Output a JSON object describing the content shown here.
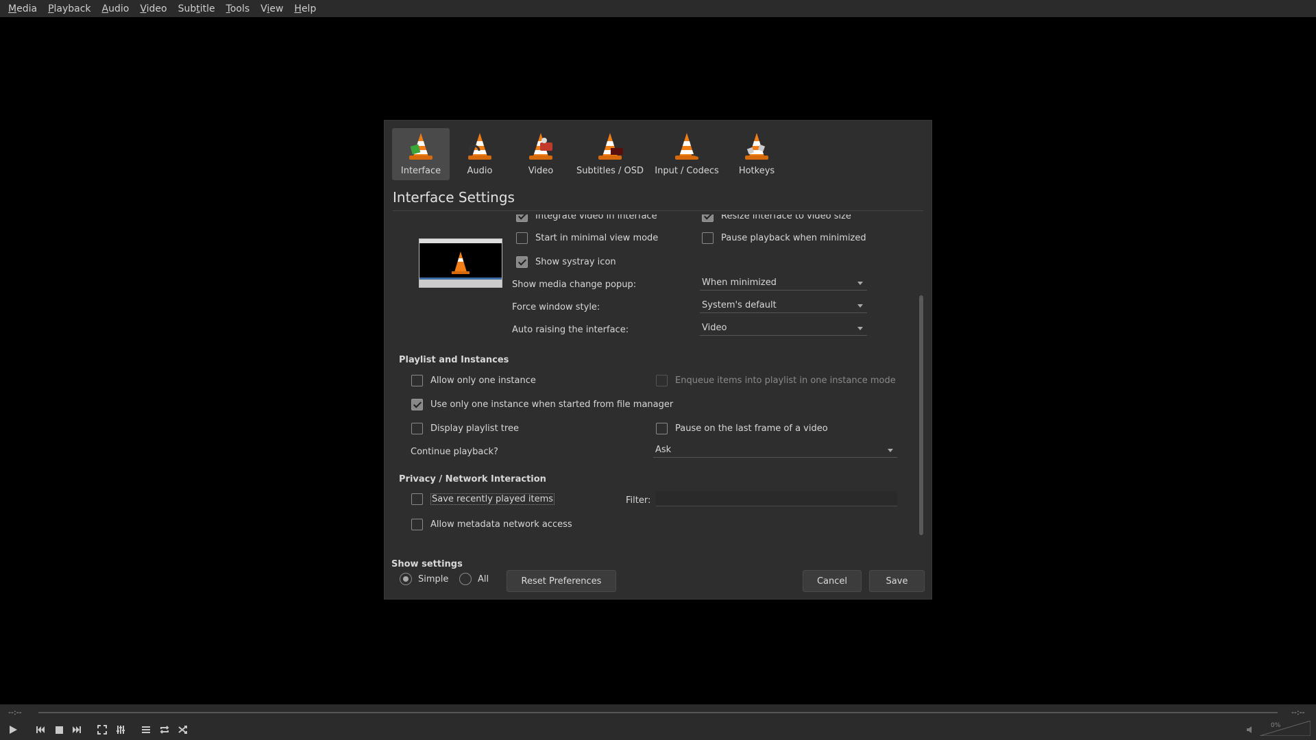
{
  "menu": [
    "Media",
    "Playback",
    "Audio",
    "Video",
    "Subtitle",
    "Tools",
    "View",
    "Help"
  ],
  "menu_mnemonics": [
    "M",
    "P",
    "A",
    "V",
    "t",
    "T",
    "i",
    "H"
  ],
  "dialog": {
    "categories": [
      {
        "label": "Interface",
        "icon": "interface-cone-icon",
        "active": true
      },
      {
        "label": "Audio",
        "icon": "audio-cone-icon",
        "active": false
      },
      {
        "label": "Video",
        "icon": "video-cone-icon",
        "active": false
      },
      {
        "label": "Subtitles / OSD",
        "icon": "subtitles-cone-icon",
        "active": false
      },
      {
        "label": "Input / Codecs",
        "icon": "input-codecs-cone-icon",
        "active": false
      },
      {
        "label": "Hotkeys",
        "icon": "hotkeys-cone-icon",
        "active": false
      }
    ],
    "title": "Interface Settings",
    "look": {
      "integrate_video": {
        "label": "Integrate video in interface",
        "checked": true
      },
      "resize_interface": {
        "label": "Resize interface to video size",
        "checked": true
      },
      "minimal_view": {
        "label": "Start in minimal view mode",
        "checked": false
      },
      "pause_minimized": {
        "label": "Pause playback when minimized",
        "checked": false
      },
      "systray": {
        "label": "Show systray icon",
        "checked": true
      },
      "media_popup_label": "Show media change popup:",
      "media_popup_value": "When minimized",
      "window_style_label": "Force window style:",
      "window_style_value": "System's default",
      "auto_raise_label": "Auto raising the interface:",
      "auto_raise_value": "Video"
    },
    "playlist": {
      "heading": "Playlist and Instances",
      "one_instance": {
        "label": "Allow only one instance",
        "checked": false
      },
      "enqueue": {
        "label": "Enqueue items into playlist in one instance mode",
        "checked": false,
        "disabled": true
      },
      "file_manager": {
        "label": "Use only one instance when started from file manager",
        "checked": true
      },
      "playlist_tree": {
        "label": "Display playlist tree",
        "checked": false
      },
      "pause_last_frame": {
        "label": "Pause on the last frame of a video",
        "checked": false
      },
      "continue_label": "Continue playback?",
      "continue_value": "Ask"
    },
    "privacy": {
      "heading": "Privacy / Network Interaction",
      "recent": {
        "label": "Save recently played items",
        "checked": false
      },
      "filter_label": "Filter:",
      "filter_value": "",
      "metadata": {
        "label": "Allow metadata network access",
        "checked": false
      }
    },
    "show_settings": {
      "label": "Show settings",
      "simple": "Simple",
      "all": "All",
      "selected": "Simple"
    },
    "buttons": {
      "reset": "Reset Preferences",
      "cancel": "Cancel",
      "save": "Save"
    }
  },
  "player": {
    "elapsed": "--:--",
    "remaining": "--:--",
    "volume": "0%"
  }
}
